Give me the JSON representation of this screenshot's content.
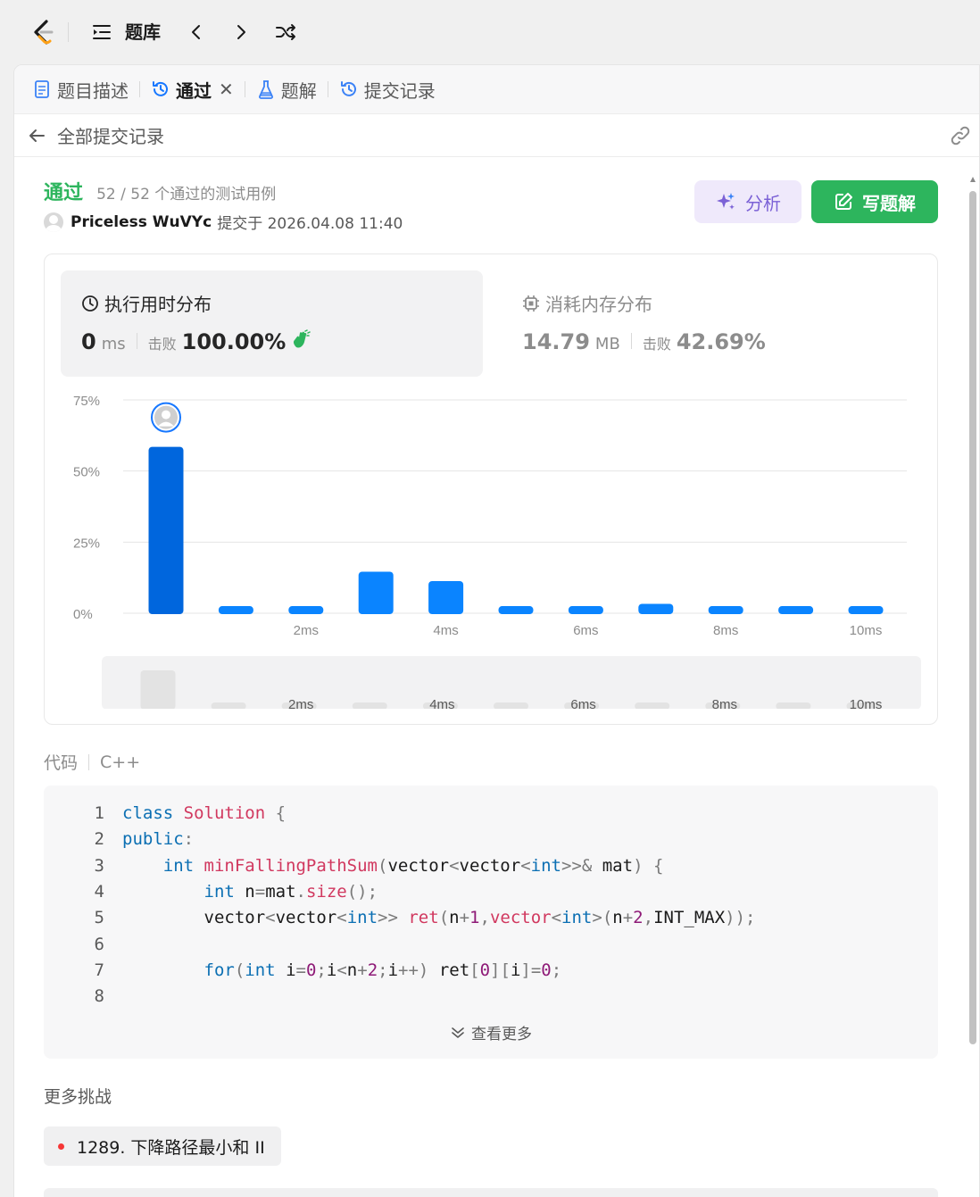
{
  "topbar": {
    "title": "题库"
  },
  "tabs": [
    {
      "label": "题目描述",
      "icon": "document-icon"
    },
    {
      "label": "通过",
      "icon": "history-icon",
      "active": true
    },
    {
      "label": "题解",
      "icon": "flask-icon"
    },
    {
      "label": "提交记录",
      "icon": "history-icon"
    }
  ],
  "subheader": {
    "back_label": "全部提交记录"
  },
  "submission": {
    "status": "通过",
    "cases": "52 / 52 个通过的测试用例",
    "user": "Priceless WuVYc",
    "submitted_at": "提交于 2026.04.08 11:40"
  },
  "actions": {
    "analyze": "分析",
    "write_solution": "写题解"
  },
  "runtime": {
    "title": "执行用时分布",
    "value": "0",
    "unit": "ms",
    "beat_label": "击败",
    "beat": "100.00%"
  },
  "memory": {
    "title": "消耗内存分布",
    "value": "14.79",
    "unit": "MB",
    "beat_label": "击败",
    "beat": "42.69%"
  },
  "chart_data": {
    "type": "bar",
    "categories": [
      "0ms",
      "1ms",
      "2ms",
      "3ms",
      "4ms",
      "5ms",
      "6ms",
      "7ms",
      "8ms",
      "9ms",
      "10ms"
    ],
    "values": [
      58.5,
      2.5,
      2.5,
      14.6,
      11.3,
      2.5,
      2.5,
      3.3,
      2.5,
      2.5,
      2.5
    ],
    "x_tick_labels": [
      "2ms",
      "4ms",
      "6ms",
      "8ms",
      "10ms"
    ],
    "y_tick_labels": [
      "75%",
      "50%",
      "25%",
      "0%"
    ],
    "ylim": [
      0,
      75
    ],
    "highlight_index": 0,
    "colors": {
      "bar": "#0a84ff",
      "bar_highlight": "#0066dd",
      "mini_bar": "#e3e3e3"
    }
  },
  "code": {
    "label": "代码",
    "language": "C++",
    "lines": [
      {
        "n": "1",
        "tokens": [
          [
            "kw",
            "class "
          ],
          [
            "cls",
            "Solution "
          ],
          [
            "pun",
            "{"
          ]
        ]
      },
      {
        "n": "2",
        "tokens": [
          [
            "kw",
            "public"
          ],
          [
            "pun",
            ":"
          ]
        ]
      },
      {
        "n": "3",
        "tokens": [
          [
            "tx",
            "    "
          ],
          [
            "kw",
            "int "
          ],
          [
            "fn",
            "minFallingPathSum"
          ],
          [
            "pun",
            "("
          ],
          [
            "tx",
            "vector"
          ],
          [
            "pun",
            "<"
          ],
          [
            "tx",
            "vector"
          ],
          [
            "pun",
            "<"
          ],
          [
            "kw",
            "int"
          ],
          [
            "pun",
            ">>& "
          ],
          [
            "tx",
            "mat"
          ],
          [
            "pun",
            ") {"
          ]
        ]
      },
      {
        "n": "4",
        "tokens": [
          [
            "tx",
            "        "
          ],
          [
            "kw",
            "int "
          ],
          [
            "tx",
            "n"
          ],
          [
            "pun",
            "="
          ],
          [
            "tx",
            "mat"
          ],
          [
            "pun",
            "."
          ],
          [
            "fn",
            "size"
          ],
          [
            "pun",
            "();"
          ]
        ]
      },
      {
        "n": "5",
        "tokens": [
          [
            "tx",
            "        vector"
          ],
          [
            "pun",
            "<"
          ],
          [
            "tx",
            "vector"
          ],
          [
            "pun",
            "<"
          ],
          [
            "kw",
            "int"
          ],
          [
            "pun",
            ">> "
          ],
          [
            "fn",
            "ret"
          ],
          [
            "pun",
            "("
          ],
          [
            "tx",
            "n"
          ],
          [
            "pun",
            "+"
          ],
          [
            "num-c",
            "1"
          ],
          [
            "pun",
            ","
          ],
          [
            "fn",
            "vector"
          ],
          [
            "pun",
            "<"
          ],
          [
            "kw",
            "int"
          ],
          [
            "pun",
            ">("
          ],
          [
            "tx",
            "n"
          ],
          [
            "pun",
            "+"
          ],
          [
            "num-c",
            "2"
          ],
          [
            "pun",
            ","
          ],
          [
            "tx",
            "INT_MAX"
          ],
          [
            "pun",
            "));"
          ]
        ]
      },
      {
        "n": "6",
        "tokens": []
      },
      {
        "n": "7",
        "tokens": [
          [
            "tx",
            "        "
          ],
          [
            "kw",
            "for"
          ],
          [
            "pun",
            "("
          ],
          [
            "kw",
            "int "
          ],
          [
            "tx",
            "i"
          ],
          [
            "pun",
            "="
          ],
          [
            "num-c",
            "0"
          ],
          [
            "pun",
            ";"
          ],
          [
            "tx",
            "i"
          ],
          [
            "pun",
            "<"
          ],
          [
            "tx",
            "n"
          ],
          [
            "pun",
            "+"
          ],
          [
            "num-c",
            "2"
          ],
          [
            "pun",
            ";"
          ],
          [
            "tx",
            "i"
          ],
          [
            "pun",
            "++) "
          ],
          [
            "tx",
            "ret"
          ],
          [
            "pun",
            "["
          ],
          [
            "num-c",
            "0"
          ],
          [
            "pun",
            "]["
          ],
          [
            "tx",
            "i"
          ],
          [
            "pun",
            "]="
          ],
          [
            "num-c",
            "0"
          ],
          [
            "pun",
            ";"
          ]
        ]
      },
      {
        "n": "8",
        "tokens": []
      }
    ],
    "more": "查看更多"
  },
  "challenges": {
    "label": "更多挑战",
    "items": [
      "1289. 下降路径最小和 II"
    ]
  }
}
